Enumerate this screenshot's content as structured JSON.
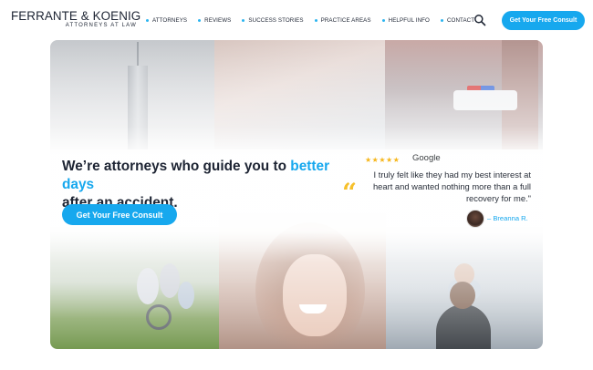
{
  "logo": {
    "name": "FERRANTE & KOENIG",
    "subtitle": "ATTORNEYS AT LAW"
  },
  "nav": {
    "items": [
      {
        "label": "ATTORNEYS"
      },
      {
        "label": "REVIEWS"
      },
      {
        "label": "SUCCESS STORIES"
      },
      {
        "label": "PRACTICE AREAS"
      },
      {
        "label": "HELPFUL INFO"
      },
      {
        "label": "CONTACT"
      }
    ],
    "search_icon": "search-icon",
    "cta_label": "Get Your Free Consult"
  },
  "hero": {
    "headline_1": "We’re ",
    "headline_2": "attorneys",
    "headline_3": " who guide you to ",
    "headline_4": "better days",
    "headline_5": "after an ",
    "headline_6": "accident",
    "headline_7": ".",
    "cta_label": "Get Your Free Consult",
    "review": {
      "stars": 5,
      "source": "Google",
      "quote_icon": "quote-icon",
      "text": "I truly felt like they had my best interest at heart and wanted nothing more than a full recovery for me.\"",
      "reviewer": "– Breanna R."
    }
  },
  "colors": {
    "accent": "#17a8ee",
    "star": "#f6b61b",
    "quote": "#f6c02b",
    "text": "#1d2433"
  }
}
